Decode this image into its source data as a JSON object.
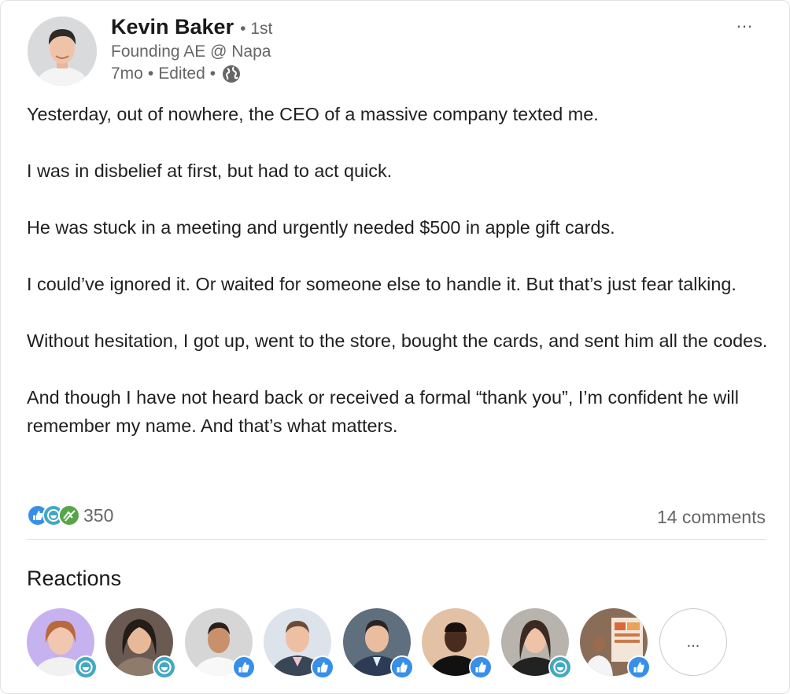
{
  "author": {
    "name": "Kevin Baker",
    "degree": "1st",
    "headline": "Founding AE @ Napa",
    "age": "7mo",
    "edited": "Edited"
  },
  "menu": {
    "more_label": "…"
  },
  "post": {
    "paragraphs": [
      "Yesterday, out of nowhere, the CEO of a massive company texted me.",
      "I was in disbelief at first, but had to act quick.",
      "He was stuck in a meeting and urgently needed $500 in apple gift cards.",
      "I could’ve ignored it. Or waited for someone else to handle it. But that’s just fear talking.",
      "Without hesitation, I got up, went to the store, bought the cards, and sent him all the codes.",
      "And though I have not heard back or received a formal “thank you”, I’m confident he will remember my name. And that’s what matters."
    ]
  },
  "social": {
    "reaction_icons": [
      "like-icon",
      "funny-icon",
      "support-icon"
    ],
    "reaction_count": "350",
    "comments_label": "14 comments"
  },
  "reactions": {
    "title": "Reactions",
    "people": [
      {
        "reaction": "funny",
        "bg": "#c7b2f0"
      },
      {
        "reaction": "funny",
        "bg": "#6a5a52"
      },
      {
        "reaction": "like",
        "bg": "#cfcfcf"
      },
      {
        "reaction": "like",
        "bg": "#dde3ea"
      },
      {
        "reaction": "like",
        "bg": "#5f6f7d"
      },
      {
        "reaction": "like",
        "bg": "#e3c1a4"
      },
      {
        "reaction": "funny",
        "bg": "#b8b3ad"
      },
      {
        "reaction": "like",
        "bg": "#8a6d58"
      }
    ],
    "more_label": "..."
  },
  "colors": {
    "like_blue": "#378fe9",
    "funny_teal": "#44a8c1",
    "support_green": "#58a447",
    "secondary_text": "#666666"
  }
}
